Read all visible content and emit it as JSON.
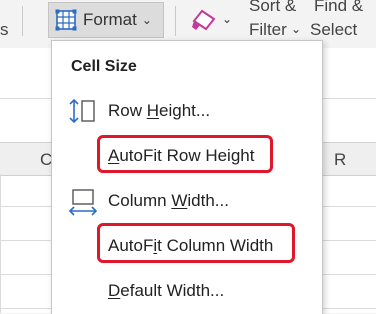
{
  "ribbon": {
    "left_fragment": "s",
    "format_button": {
      "label": "Format",
      "icon": "format-cells-icon"
    },
    "clear_icon": "eraser-icon",
    "sort_filter": {
      "line1": "Sort &",
      "line2": "Filter"
    },
    "find_select": {
      "line1": "Find &",
      "line2": "Select"
    }
  },
  "sheet": {
    "columns": [
      "C",
      "R"
    ]
  },
  "menu": {
    "heading": "Cell Size",
    "items": [
      {
        "pre": "Row ",
        "key": "H",
        "post": "eight...",
        "icon": "row-height-icon",
        "highlighted": false
      },
      {
        "pre": "",
        "key": "A",
        "post": "utoFit Row Height",
        "icon": "",
        "highlighted": true
      },
      {
        "pre": "Column ",
        "key": "W",
        "post": "idth...",
        "icon": "column-width-icon",
        "highlighted": false
      },
      {
        "pre": "AutoF",
        "key": "i",
        "post": "t Column Width",
        "icon": "",
        "highlighted": true
      },
      {
        "pre": "",
        "key": "D",
        "post": "efault Width...",
        "icon": "",
        "highlighted": false
      }
    ]
  },
  "colors": {
    "highlight": "#e0162b",
    "icon_blue": "#2b6cc4",
    "eraser_pink": "#c43a9a"
  }
}
